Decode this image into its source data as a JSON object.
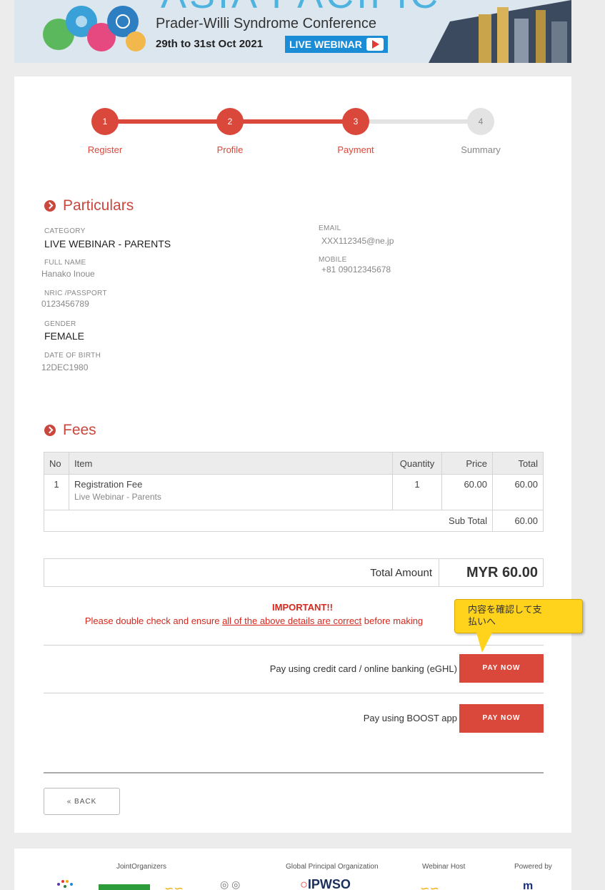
{
  "banner": {
    "top_title": "ASIA PACIFIC",
    "subtitle": "Prader-Willi Syndrome Conference",
    "dates": "29th to 31st Oct 2021",
    "live_label": "LIVE WEBINAR"
  },
  "steps": [
    {
      "num": "1",
      "label": "Register",
      "state": "done"
    },
    {
      "num": "2",
      "label": "Profile",
      "state": "done"
    },
    {
      "num": "3",
      "label": "Payment",
      "state": "active"
    },
    {
      "num": "4",
      "label": "Summary",
      "state": "todo"
    }
  ],
  "particulars": {
    "heading": "Particulars",
    "category_label": "CATEGORY",
    "category": "LIVE WEBINAR - PARENTS",
    "fullname_label": "FULL NAME",
    "fullname": "Hanako Inoue",
    "nric_label": "NRIC /PASSPORT",
    "nric": "0123456789",
    "gender_label": "GENDER",
    "gender": "FEMALE",
    "dob_label": "DATE OF BIRTH",
    "dob": "12DEC1980",
    "email_label": "EMAIL",
    "email": "XXX112345@ne.jp",
    "mobile_label": "MOBILE",
    "mobile": "+81 09012345678"
  },
  "fees": {
    "heading": "Fees",
    "columns": [
      "No",
      "Item",
      "Quantity",
      "Price",
      "Total"
    ],
    "rows": [
      {
        "no": "1",
        "item": "Registration Fee",
        "sub": "Live Webinar - Parents",
        "qty": "1",
        "price": "60.00",
        "total": "60.00"
      }
    ],
    "subtotal_label": "Sub Total",
    "subtotal": "60.00"
  },
  "total": {
    "label": "Total Amount",
    "amount": "MYR 60.00"
  },
  "important": {
    "title": "IMPORTANT!!",
    "pre": "Please double check and ensure ",
    "link": "all of the above details are correct",
    "post": " before making"
  },
  "tooltip": {
    "line1": "内容を確認して支",
    "line2": "払いへ"
  },
  "payments": [
    {
      "text": "Pay using credit card / online banking (eGHL)",
      "button": "PAY NOW"
    },
    {
      "text": "Pay using BOOST app",
      "button": "PAY NOW"
    }
  ],
  "back_button": "« BACK",
  "footer": {
    "joint": "JointOrganizers",
    "global": "Global Principal Organization",
    "host": "Webinar Host",
    "powered": "Powered by",
    "ipwso": "IPWSO"
  },
  "colors": {
    "accent": "#d9483b",
    "important": "#d6281e",
    "tooltip": "#ffd21c"
  }
}
